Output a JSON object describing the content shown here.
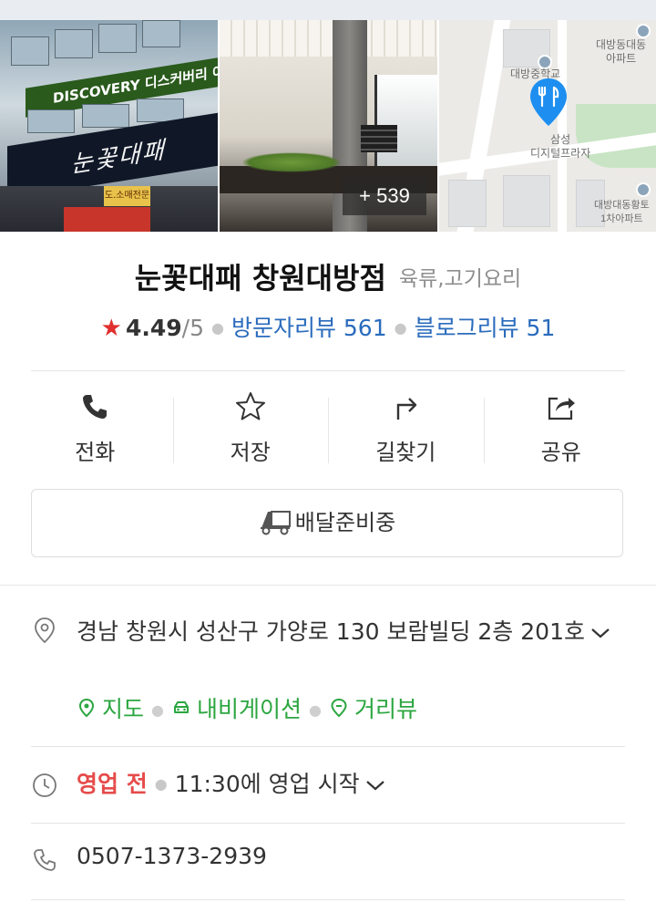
{
  "photos": {
    "extra_count": "+ 539",
    "building_sign_main": "DISCOVERY 디스커버리 어학원",
    "building_sign_store": "눈꽃대패",
    "building_sign_small": "도.소매전문",
    "map_labels": {
      "school": "대방중학교",
      "apartment": "대방동대동\n아파트",
      "plaza": "삼성\n디지털프라자",
      "apartment2": "대방대동황토\n1차아파트"
    }
  },
  "place": {
    "name": "눈꽃대패 창원대방점",
    "category": "육류,고기요리",
    "rating_star": "★",
    "rating": "4.49",
    "rating_max": "/5",
    "visitor_reviews": "방문자리뷰 561",
    "blog_reviews": "블로그리뷰 51"
  },
  "actions": [
    {
      "label": "전화",
      "icon": "phone-icon"
    },
    {
      "label": "저장",
      "icon": "star-outline-icon"
    },
    {
      "label": "길찾기",
      "icon": "directions-icon"
    },
    {
      "label": "공유",
      "icon": "share-icon"
    }
  ],
  "delivery": {
    "label": "배달준비중",
    "icon": "delivery-truck-icon"
  },
  "address": {
    "text": "경남 창원시 성산구 가양로 130 보람빌딩 2층 201호",
    "icon": "location-pin-icon"
  },
  "links": {
    "map": "지도",
    "navigation": "내비게이션",
    "street_view": "거리뷰"
  },
  "hours": {
    "status": "영업 전",
    "detail": "11:30에 영업 시작",
    "icon": "clock-icon"
  },
  "phone": {
    "number": "0507-1373-2939",
    "icon": "phone-outline-icon"
  },
  "colors": {
    "accent_blue": "#2a6bbd",
    "link_green": "#2ba640",
    "closed_red": "#e64b4b",
    "star_red": "#e02f2f",
    "map_pin_blue": "#1e8ff0"
  }
}
